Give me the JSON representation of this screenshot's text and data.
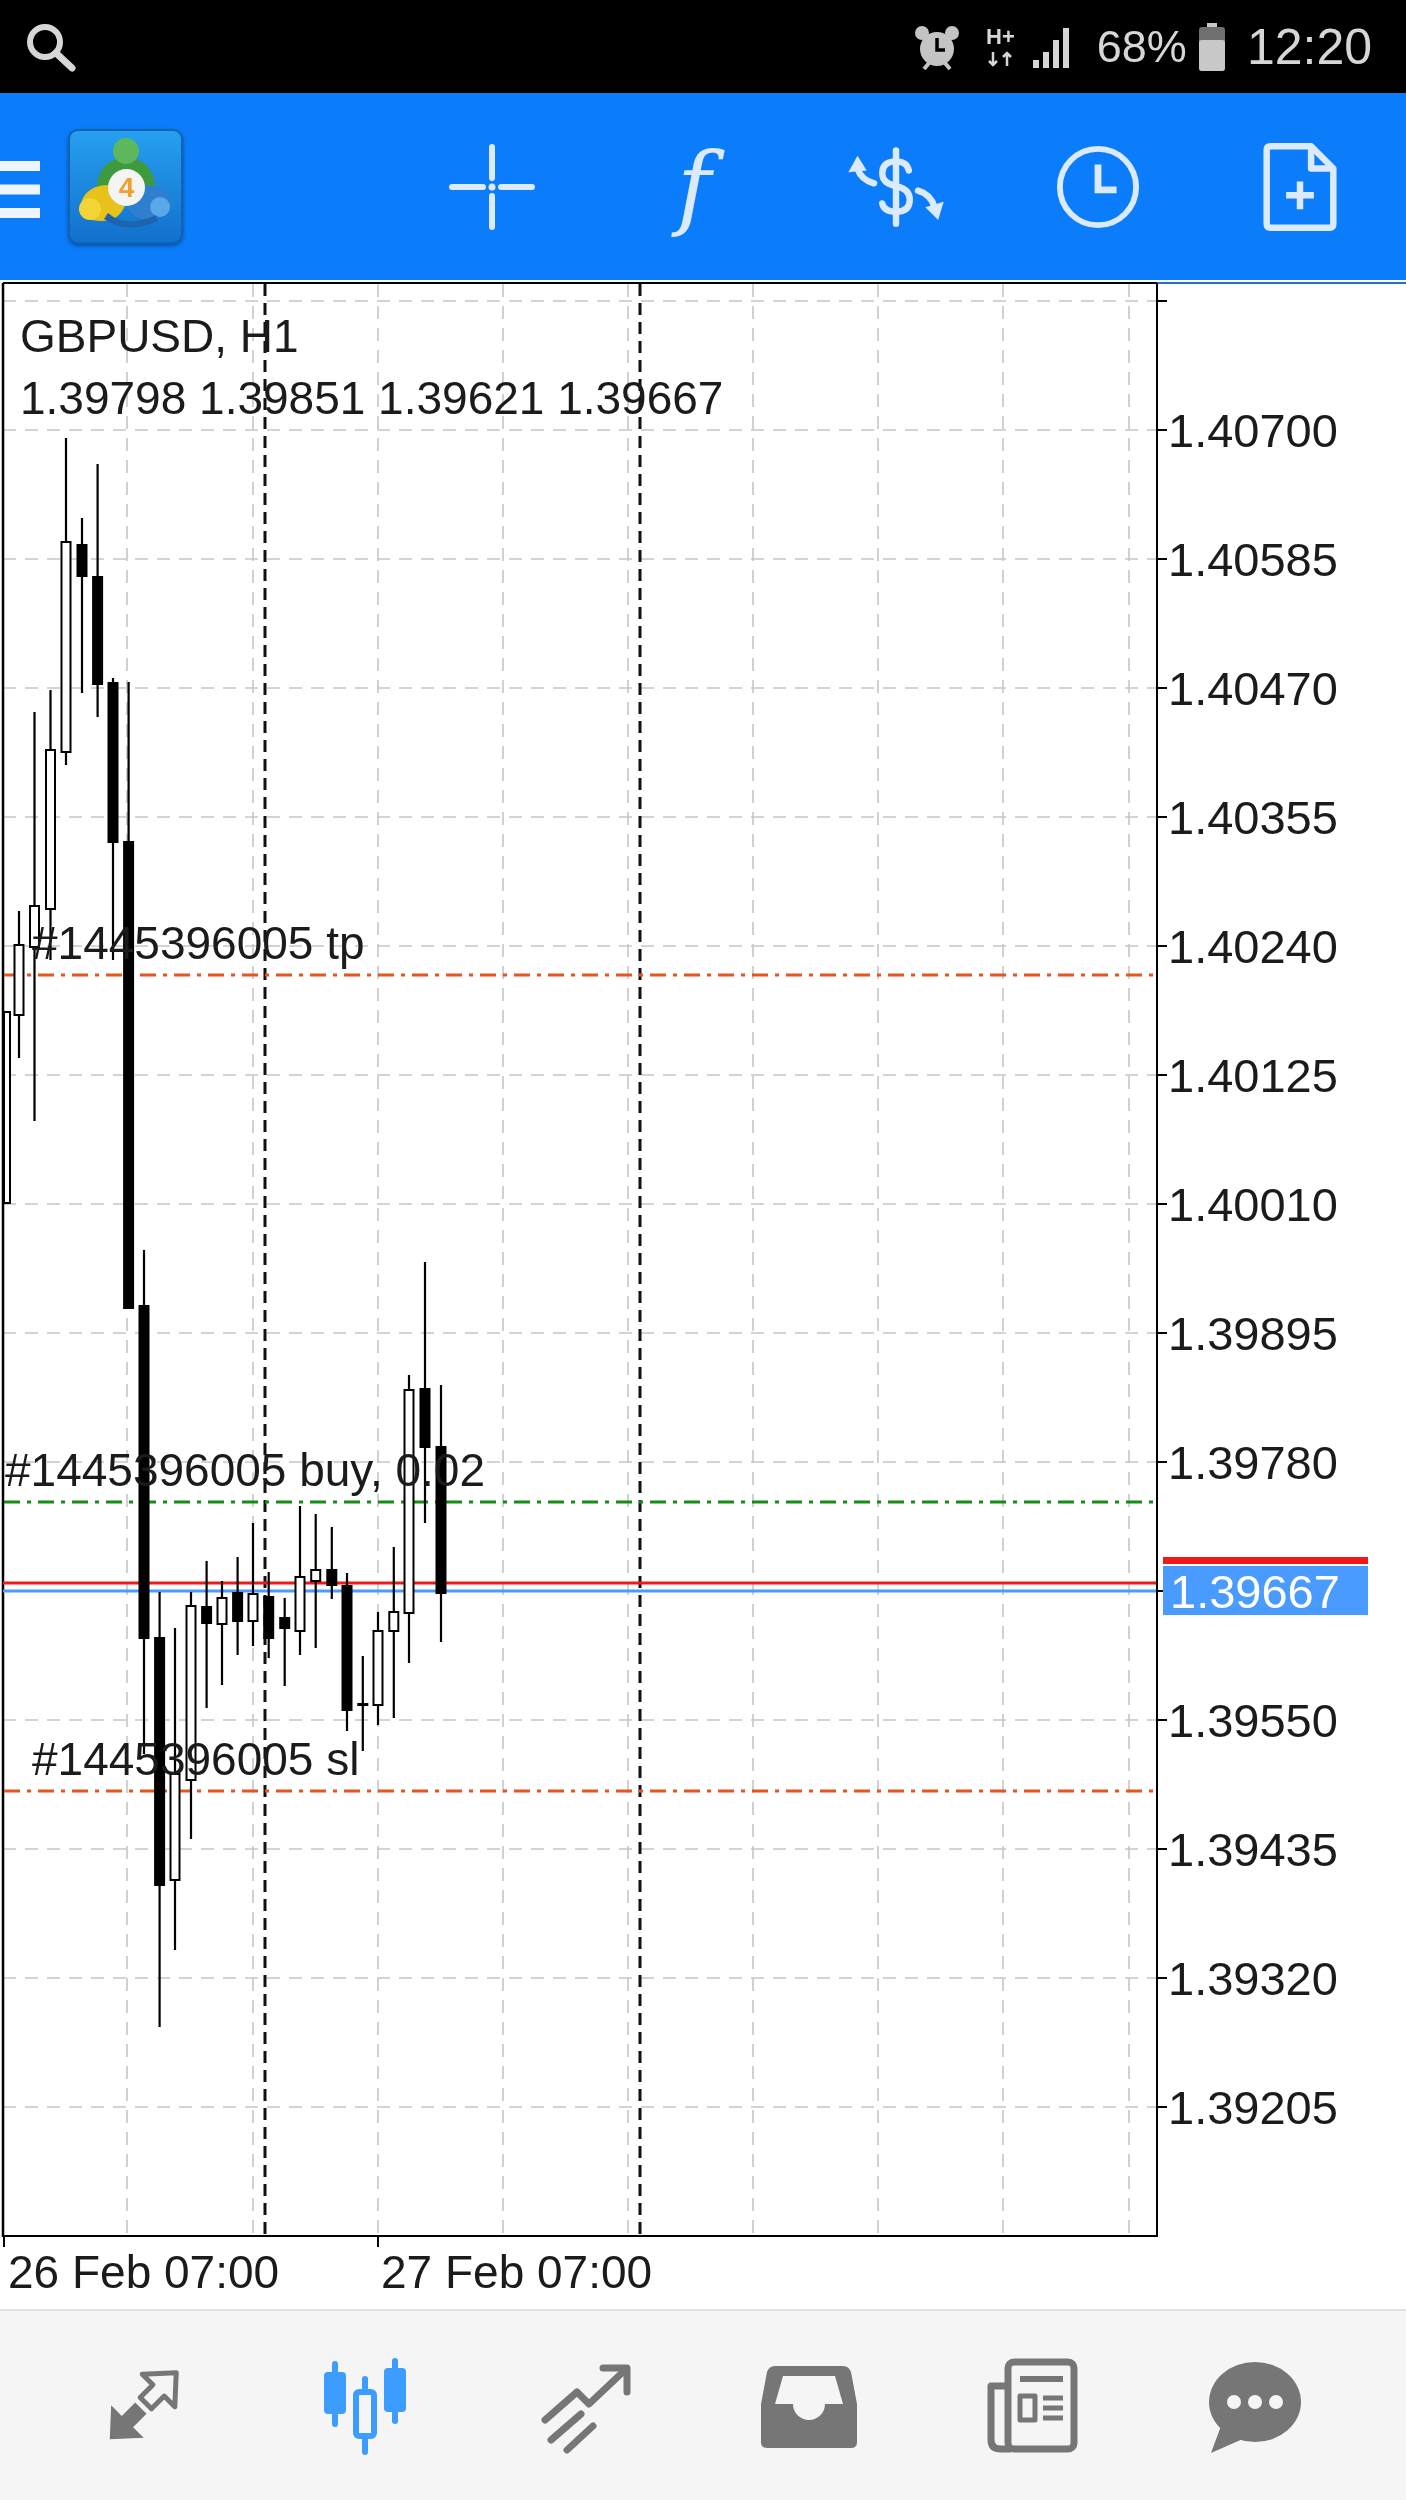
{
  "status_bar": {
    "network": "H+",
    "battery": "68%",
    "time": "12:20"
  },
  "toolbar": {
    "logo_badge": "4",
    "indicator_symbol": "f"
  },
  "chart": {
    "symbol": "GBPUSD, H1",
    "ohlc": "1.39798 1.39851 1.39621 1.39667",
    "order_lines": [
      {
        "label": "#1445396005 tp",
        "color": "#e8541e"
      },
      {
        "label": "#1445396005 buy, 0.02",
        "color": "#188a18"
      },
      {
        "label": "#1445396005 sl",
        "color": "#e8541e"
      }
    ],
    "price_scale": [
      "1.40700",
      "1.40585",
      "1.40470",
      "1.40355",
      "1.40240",
      "1.40125",
      "1.40010",
      "1.39895",
      "1.39780",
      "1.39550",
      "1.39435",
      "1.39320",
      "1.39205"
    ],
    "current_price": "1.39667",
    "time_scale": [
      "26 Feb 07:00",
      "27 Feb 07:00"
    ]
  },
  "bottom_nav": {
    "items": [
      {
        "selected": false
      },
      {
        "selected": true
      },
      {
        "selected": false
      },
      {
        "selected": false
      },
      {
        "selected": false
      },
      {
        "selected": false
      }
    ]
  }
}
